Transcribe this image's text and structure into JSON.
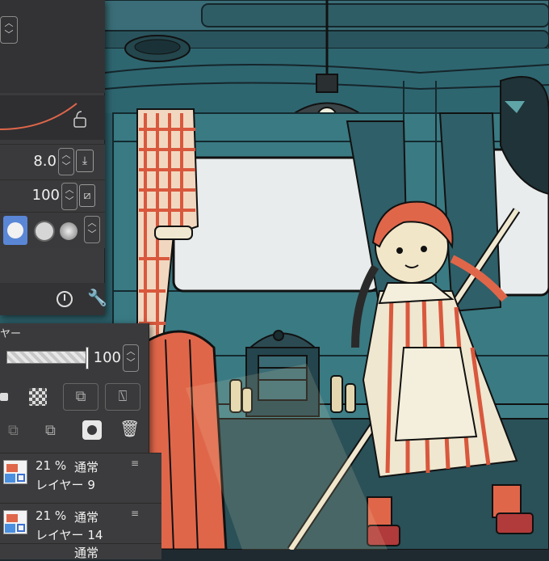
{
  "canvas": {
    "description_name": "illustration-canvas",
    "colors": {
      "teal": "#2e6670",
      "dark_teal": "#1d3f47",
      "cream": "#efe7cf",
      "red": "#e0664a",
      "window": "#e8eaea"
    }
  },
  "brush_panel": {
    "size_value": "8.0",
    "opacity_value": "100",
    "lock_icon": "lock-open-icon",
    "download_icon": "download-icon",
    "tool_icons": [
      "clock-icon",
      "wrench-icon"
    ]
  },
  "layer_panel": {
    "title": "ヤー",
    "opacity_value": "100",
    "layers": [
      {
        "percent": "21 %",
        "mode": "通常",
        "name": "レイヤー 9"
      },
      {
        "percent": "21 %",
        "mode": "通常",
        "name": "レイヤー 14"
      },
      {
        "percent": "",
        "mode": "通常",
        "name": ""
      }
    ]
  }
}
